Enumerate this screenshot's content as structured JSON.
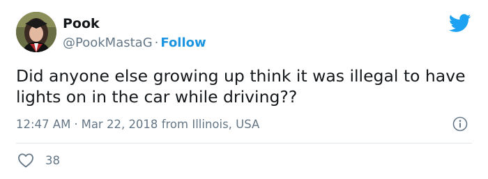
{
  "tweet": {
    "author_name": "Pook",
    "handle": "@PookMastaG",
    "separator": "·",
    "follow_label": "Follow",
    "text": "Did anyone else growing up think it was illegal to have lights on in the car while driving??",
    "time": "12:47 AM",
    "date": "Mar 22, 2018",
    "location": "from Illinois, USA",
    "like_count": "38"
  },
  "icons": {
    "brand": "twitter-bird-icon",
    "info": "info-icon",
    "like": "heart-icon"
  },
  "colors": {
    "brand": "#1da1f2",
    "follow": "#1b95e0",
    "text": "#14171a",
    "muted": "#657786",
    "divider": "#e1e8ed"
  }
}
